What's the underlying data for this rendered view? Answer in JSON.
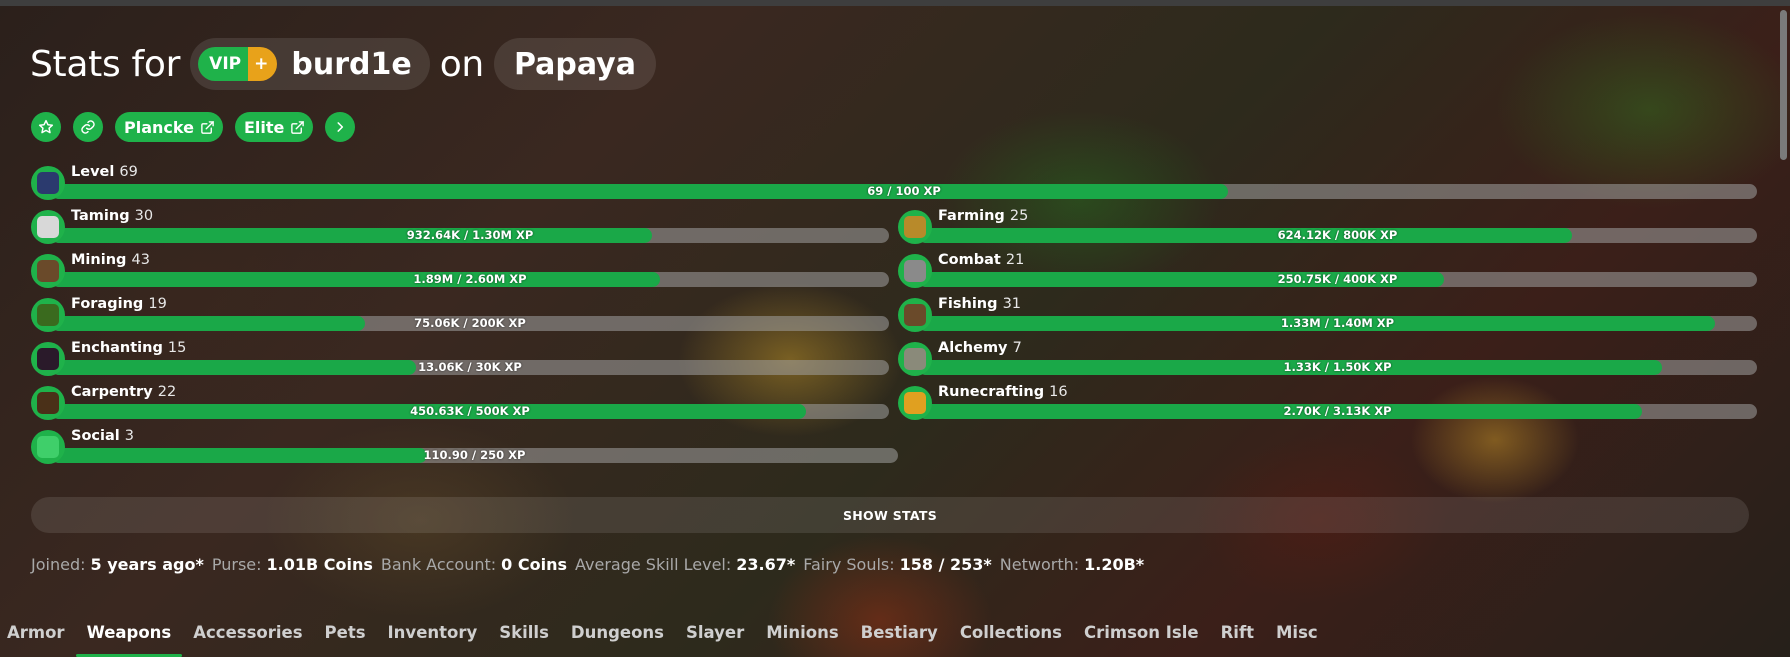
{
  "header": {
    "prefix": "Stats for",
    "rank_main": "VIP",
    "rank_plus": "+",
    "username": "burd1e",
    "on_text": "on",
    "profile": "Papaya"
  },
  "toolbar": {
    "plancke_label": "Plancke",
    "elite_label": "Elite"
  },
  "skills": {
    "level": {
      "name": "Level",
      "level": "69",
      "progress": "69 / 100 XP",
      "fill": 0.69,
      "icon_color": "#2b3a6e"
    },
    "taming": {
      "name": "Taming",
      "level": "30",
      "progress": "932.64K / 1.30M XP",
      "fill": 0.717,
      "icon_color": "#d8d8d8"
    },
    "farming": {
      "name": "Farming",
      "level": "25",
      "progress": "624.12K / 800K XP",
      "fill": 0.78,
      "icon_color": "#b88a2a"
    },
    "mining": {
      "name": "Mining",
      "level": "43",
      "progress": "1.89M / 2.60M XP",
      "fill": 0.727,
      "icon_color": "#6a4a2a"
    },
    "combat": {
      "name": "Combat",
      "level": "21",
      "progress": "250.75K / 400K XP",
      "fill": 0.627,
      "icon_color": "#8a8a8a"
    },
    "foraging": {
      "name": "Foraging",
      "level": "19",
      "progress": "75.06K / 200K XP",
      "fill": 0.375,
      "icon_color": "#3a6a1e"
    },
    "fishing": {
      "name": "Fishing",
      "level": "31",
      "progress": "1.33M / 1.40M XP",
      "fill": 0.95,
      "icon_color": "#6a4a2a"
    },
    "enchanting": {
      "name": "Enchanting",
      "level": "15",
      "progress": "13.06K / 30K XP",
      "fill": 0.435,
      "icon_color": "#2a1a2a"
    },
    "alchemy": {
      "name": "Alchemy",
      "level": "7",
      "progress": "1.33K / 1.50K XP",
      "fill": 0.887,
      "icon_color": "#8a8a7a"
    },
    "carpentry": {
      "name": "Carpentry",
      "level": "22",
      "progress": "450.63K / 500K XP",
      "fill": 0.901,
      "icon_color": "#4a3018"
    },
    "runecrafting": {
      "name": "Runecrafting",
      "level": "16",
      "progress": "2.70K / 3.13K XP",
      "fill": 0.863,
      "icon_color": "#e0a020"
    },
    "social": {
      "name": "Social",
      "level": "3",
      "progress": "110.90 / 250 XP",
      "fill": 0.444,
      "icon_color": "#3fcf6a"
    }
  },
  "show_stats_label": "SHOW STATS",
  "info": {
    "joined_label": "Joined:",
    "joined_value": "5 years ago*",
    "purse_label": "Purse:",
    "purse_value": "1.01B Coins",
    "bank_label": "Bank Account:",
    "bank_value": "0 Coins",
    "avg_label": "Average Skill Level:",
    "avg_value": "23.67*",
    "fairy_label": "Fairy Souls:",
    "fairy_value": "158 / 253*",
    "networth_label": "Networth:",
    "networth_value": "1.20B*"
  },
  "tabs": [
    "Armor",
    "Weapons",
    "Accessories",
    "Pets",
    "Inventory",
    "Skills",
    "Dungeons",
    "Slayer",
    "Minions",
    "Bestiary",
    "Collections",
    "Crimson Isle",
    "Rift",
    "Misc"
  ],
  "active_tab": "Weapons",
  "colors": {
    "accent": "#1fb24a",
    "rank_plus": "#e8a21a"
  }
}
